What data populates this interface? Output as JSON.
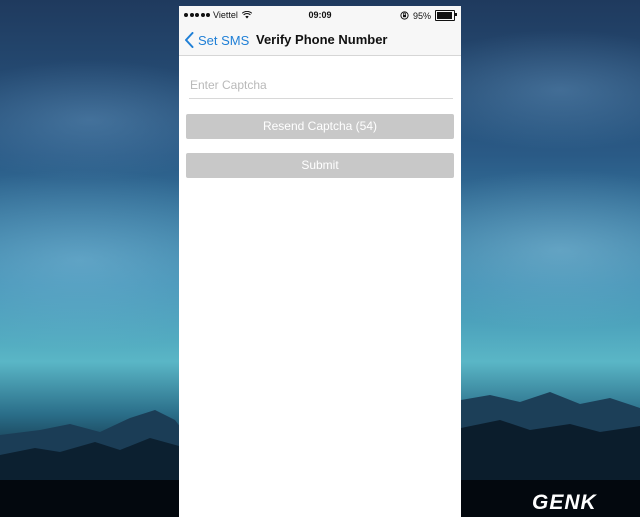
{
  "status_bar": {
    "carrier": "Viettel",
    "time": "09:09",
    "battery": "95%"
  },
  "nav": {
    "back_label": "Set SMS",
    "title": "Verify Phone Number"
  },
  "form": {
    "captcha_placeholder": "Enter Captcha",
    "captcha_value": "",
    "resend_label": "Resend Captcha (54)",
    "submit_label": "Submit"
  },
  "watermark": "GENK",
  "colors": {
    "accent": "#1f7fd6",
    "button_disabled": "#c8c8c8"
  },
  "battery_level": 0.95
}
